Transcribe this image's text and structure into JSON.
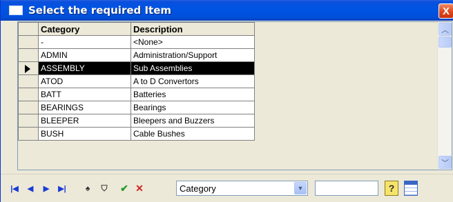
{
  "window": {
    "title": "Select the required Item",
    "close_label": "X"
  },
  "grid": {
    "headers": [
      "Category",
      "Description"
    ],
    "rows": [
      {
        "category": "-",
        "description": "<None>",
        "selected": false
      },
      {
        "category": "ADMIN",
        "description": "Administration/Support",
        "selected": false
      },
      {
        "category": "ASSEMBLY",
        "description": "Sub Assemblies",
        "selected": true
      },
      {
        "category": "ATOD",
        "description": "A to D Convertors",
        "selected": false
      },
      {
        "category": "BATT",
        "description": "Batteries",
        "selected": false
      },
      {
        "category": "BEARINGS",
        "description": "Bearings",
        "selected": false
      },
      {
        "category": "BLEEPER",
        "description": "Bleepers and Buzzers",
        "selected": false
      },
      {
        "category": "BUSH",
        "description": "Cable Bushes",
        "selected": false
      }
    ]
  },
  "toolbar": {
    "first_icon": "|◀",
    "prev_icon": "◀",
    "next_icon": "▶",
    "last_icon": "▶|",
    "find_icon": "♠",
    "filter_icon": "⛉",
    "accept_icon": "✔",
    "cancel_icon": "✕",
    "search_field_value": "Category",
    "search_text_value": "",
    "help_icon": "?"
  },
  "colors": {
    "title_bar": "#0054e3",
    "selected_row": "#000000",
    "nav_icons": "#1a3bd6",
    "accept": "#2a9a2a",
    "cancel": "#d42020"
  }
}
